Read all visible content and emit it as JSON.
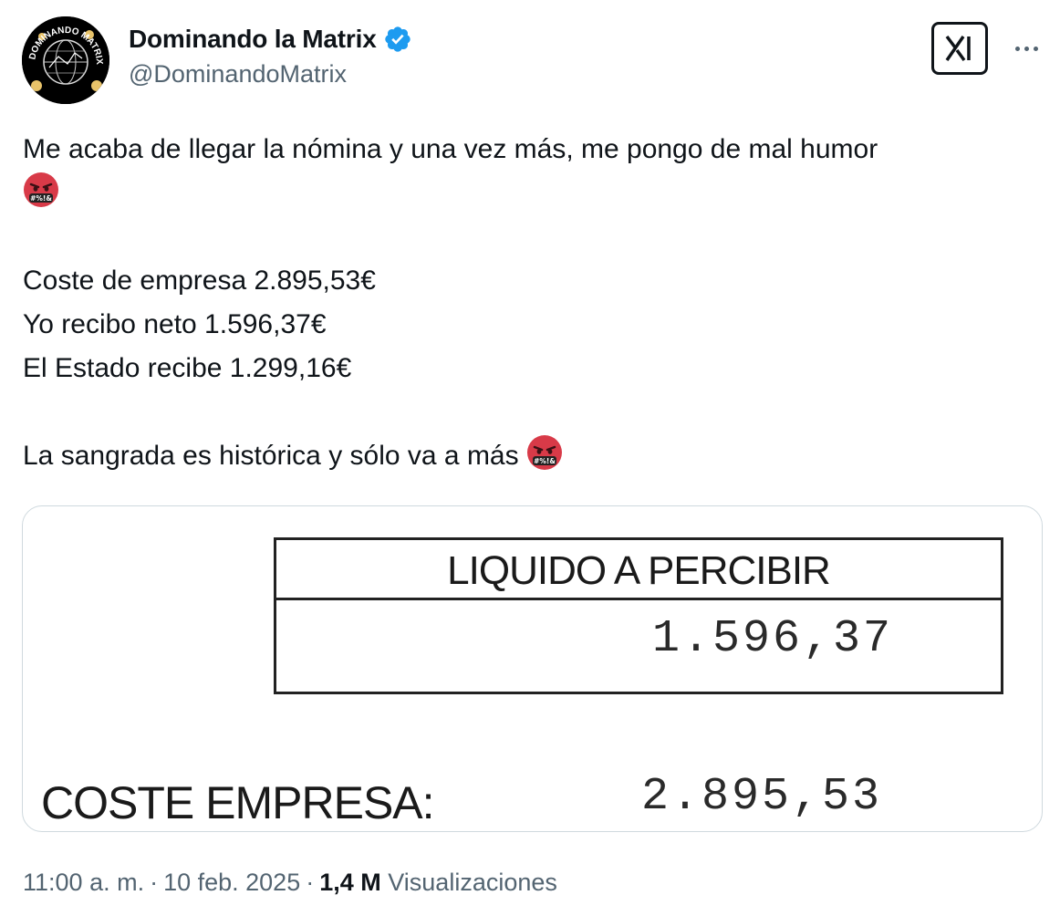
{
  "author": {
    "display_name": "Dominando la Matrix",
    "handle": "@DominandoMatrix",
    "avatar_text": "DOMINANDO MATRIX",
    "verified": true,
    "verified_color": "#1d9bf0"
  },
  "actions": {
    "grok_icon": "grok-icon",
    "more_icon": "more-icon"
  },
  "tweet": {
    "line1": "Me acaba de llegar la nómina y una vez más, me pongo de mal humor",
    "line2_emoji": "face-with-symbols-on-mouth",
    "line3": "Coste de empresa 2.895,53€",
    "line4": "Yo recibo neto 1.596,37€",
    "line5": "El Estado recibe 1.299,16€",
    "line6": "La sangrada es histórica y sólo va a más",
    "emoji_text": "#%!&"
  },
  "media": {
    "header": "LIQUIDO A PERCIBIR",
    "liquid_value": "1.596,37",
    "coste_label": "COSTE EMPRESA:",
    "coste_value": "2.895,53"
  },
  "meta": {
    "time": "11:00 a. m.",
    "date": "10 feb. 2025",
    "views_count": "1,4 M",
    "views_label": "Visualizaciones"
  }
}
